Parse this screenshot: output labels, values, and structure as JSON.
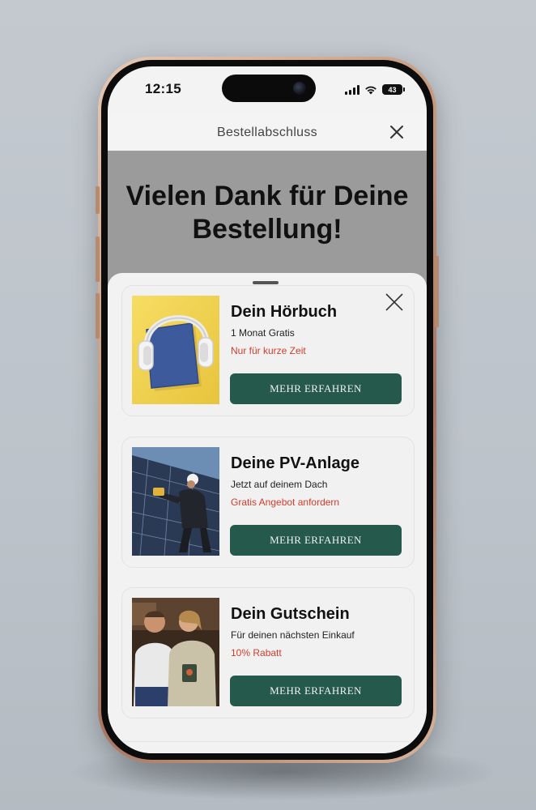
{
  "status_bar": {
    "time": "12:15",
    "battery": "43"
  },
  "header": {
    "title": "Bestellabschluss"
  },
  "hero": {
    "line1": "Vielen Dank für Deine",
    "line2": "Bestellung!"
  },
  "offers": [
    {
      "title": "Dein Hörbuch",
      "subtitle": "1 Monat Gratis",
      "highlight": "Nur für kurze Zeit",
      "button": "MEHR ERFAHREN",
      "image": "headphones-on-book"
    },
    {
      "title": "Deine PV-Anlage",
      "subtitle": "Jetzt auf deinem Dach",
      "highlight": "Gratis Angebot anfordern",
      "button": "MEHR ERFAHREN",
      "image": "worker-installing-solar-panels"
    },
    {
      "title": "Dein Gutschein",
      "subtitle": "Für deinen nächsten Einkauf",
      "highlight": "10% Rabatt",
      "button": "MEHR ERFAHREN",
      "image": "smiling-couple"
    }
  ],
  "colors": {
    "button": "#24594b",
    "highlight": "#d23d2d",
    "hero_band": "#9b9b9b"
  }
}
